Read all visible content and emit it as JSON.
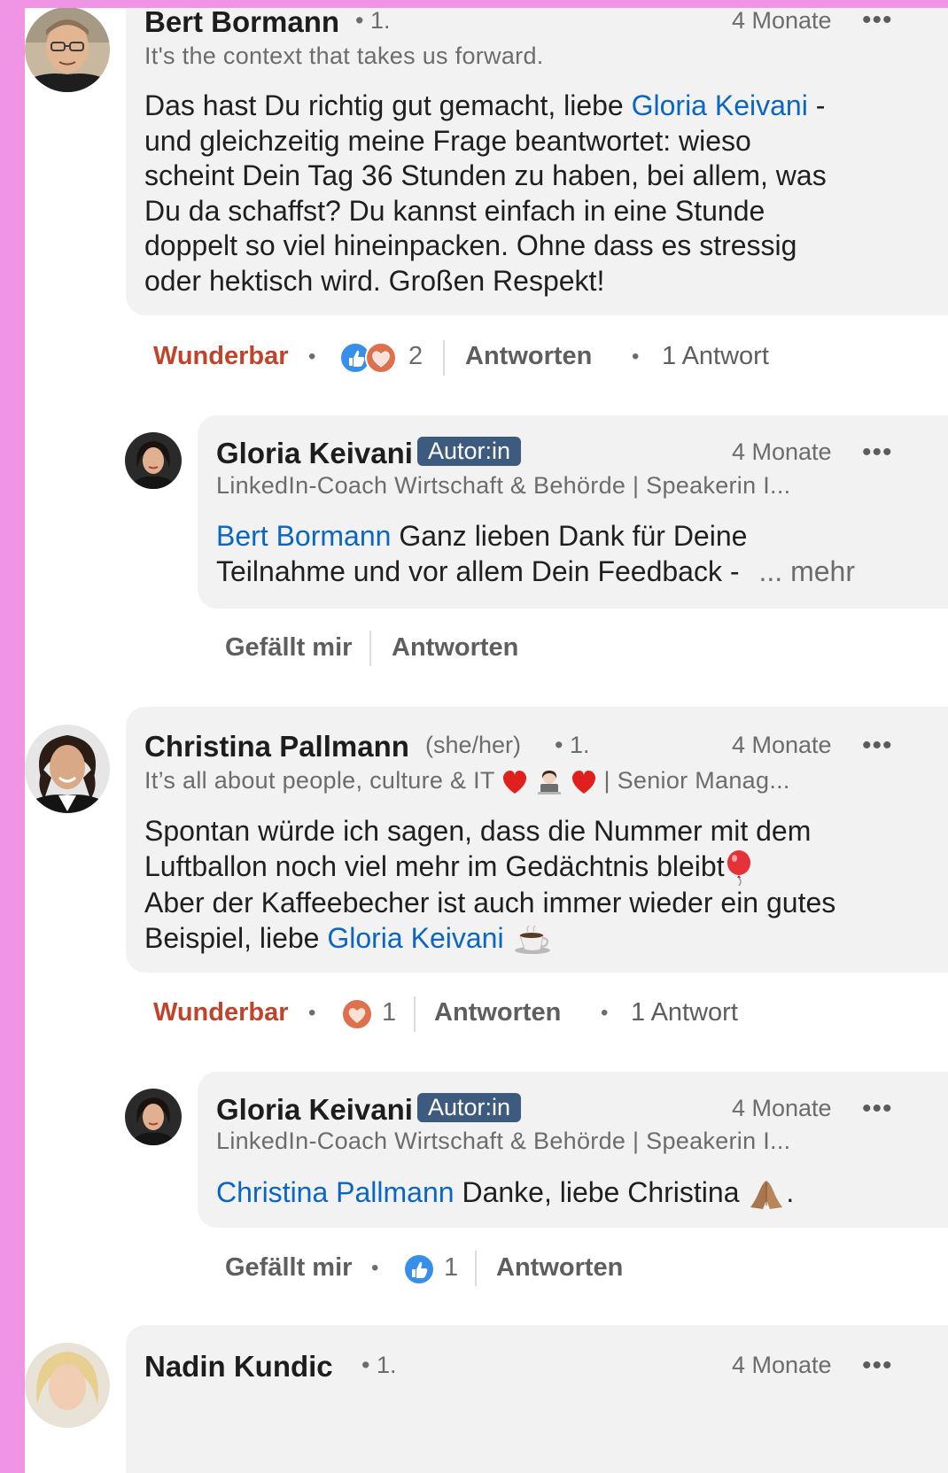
{
  "comments": [
    {
      "author": "Bert Bormann",
      "degree": "• 1.",
      "time": "4 Monate",
      "headline": "It's the context that takes us forward.",
      "body_l1_pre": "Das hast Du richtig gut gemacht, liebe ",
      "body_l1_link": "Gloria Keivani",
      "body_l1_post": " -",
      "body_l2": "und gleichzeitig meine Frage beantwortet: wieso",
      "body_l3": "scheint Dein Tag 36 Stunden zu haben, bei allem, was",
      "body_l4": "Du da schaffst? Du kannst einfach in eine Stunde",
      "body_l5": "doppelt so viel hineinpacken. Ohne dass es stressig",
      "body_l6": "oder hektisch wird. Großen Respekt!",
      "reaction_label": "Wunderbar",
      "reaction_count": "2",
      "reply_label": "Antworten",
      "replies_text": "1 Antwort"
    },
    {
      "author": "Christina Pallmann",
      "pronouns": "(she/her)",
      "degree": "• 1.",
      "time": "4 Monate",
      "headline_pre": "It’s all about people, culture & IT",
      "headline_post": "| Senior Manag...",
      "body_l1": "Spontan würde ich sagen, dass die Nummer mit dem",
      "body_l2": "Luftballon noch viel mehr im Gedächtnis bleibt",
      "body_l3": "Aber der Kaffeebecher ist auch immer wieder ein gutes",
      "body_l4_pre": "Beispiel, liebe ",
      "body_l4_link": "Gloria Keivani",
      "reaction_label": "Wunderbar",
      "reaction_count": "1",
      "reply_label": "Antworten",
      "replies_text": "1 Antwort"
    },
    {
      "author": "Nadin Kundic",
      "degree": "• 1.",
      "time": "4 Monate"
    }
  ],
  "replies": [
    {
      "author": "Gloria Keivani",
      "badge": "Autor:in",
      "time": "4 Monate",
      "headline": "LinkedIn-Coach Wirtschaft & Behörde | Speakerin I...",
      "body_l1_link": "Bert Bormann",
      "body_l1_post": " Ganz lieben Dank für Deine",
      "body_l2": "Teilnahme und vor allem Dein Feedback -",
      "more": "... mehr",
      "like_label": "Gefällt mir",
      "reply_label": "Antworten"
    },
    {
      "author": "Gloria Keivani",
      "badge": "Autor:in",
      "time": "4 Monate",
      "headline": "LinkedIn-Coach Wirtschaft & Behörde | Speakerin I...",
      "body_l1_link": "Christina Pallmann",
      "body_l1_post": " Danke, liebe Christina",
      "body_l1_end": ".",
      "like_label": "Gefällt mir",
      "like_count": "1",
      "reply_label": "Antworten"
    }
  ],
  "ui": {
    "more_icon": "•••",
    "bullet": "•",
    "colors": {
      "frame": "#f095e6",
      "link": "#0a66c2",
      "reaction": "#c0442a",
      "badge": "#3d5b7f"
    }
  }
}
